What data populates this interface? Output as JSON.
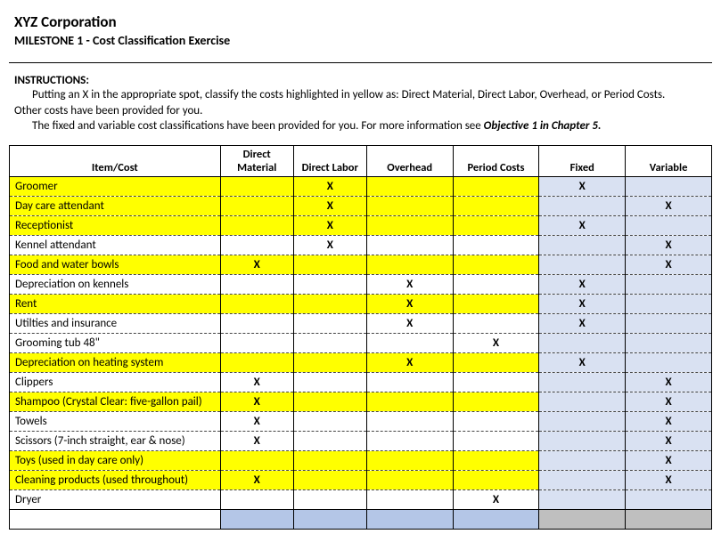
{
  "header": {
    "company": "XYZ Corporation",
    "milestone": "MILESTONE 1 - Cost Classification Exercise"
  },
  "instructions": {
    "label": "INSTRUCTIONS:",
    "line1": "Putting an X in the appropriate spot, classify the costs highlighted in yellow as:  Direct Material, Direct Labor, Overhead, or Period Costs.",
    "line2": "Other costs have been provided for you.",
    "line3a": "The fixed and variable cost classifications have been provided for you.  For more information see ",
    "line3b": "Objective 1 in Chapter 5."
  },
  "columns": {
    "item": "Item/Cost",
    "dm": "Direct Material",
    "dl": "Direct Labor",
    "oh": "Overhead",
    "pc": "Period Costs",
    "fixed": "Fixed",
    "variable": "Variable"
  },
  "mark": "X",
  "rows": [
    {
      "item": "Groomer",
      "hl": true,
      "dm": "",
      "dl": "X",
      "oh": "",
      "pc": "",
      "fixed": "X",
      "variable": ""
    },
    {
      "item": "Day care attendant",
      "hl": true,
      "dm": "",
      "dl": "X",
      "oh": "",
      "pc": "",
      "fixed": "",
      "variable": "X"
    },
    {
      "item": "Receptionist",
      "hl": true,
      "dm": "",
      "dl": "X",
      "oh": "",
      "pc": "",
      "fixed": "X",
      "variable": ""
    },
    {
      "item": "Kennel attendant",
      "hl": false,
      "dm": "",
      "dl": "X",
      "oh": "",
      "pc": "",
      "fixed": "",
      "variable": "X"
    },
    {
      "item": "Food and water bowls",
      "hl": true,
      "dm": "X",
      "dl": "",
      "oh": "",
      "pc": "",
      "fixed": "",
      "variable": "X"
    },
    {
      "item": "Depreciation on kennels",
      "hl": false,
      "dm": "",
      "dl": "",
      "oh": "X",
      "pc": "",
      "fixed": "X",
      "variable": ""
    },
    {
      "item": "Rent",
      "hl": true,
      "dm": "",
      "dl": "",
      "oh": "X",
      "pc": "",
      "fixed": "X",
      "variable": ""
    },
    {
      "item": "Utilties and insurance",
      "hl": false,
      "dm": "",
      "dl": "",
      "oh": "X",
      "pc": "",
      "fixed": "X",
      "variable": ""
    },
    {
      "item": "Grooming tub 48\"",
      "hl": false,
      "dm": "",
      "dl": "",
      "oh": "",
      "pc": "X",
      "fixed": "",
      "variable": ""
    },
    {
      "item": "Depreciation on heating system",
      "hl": true,
      "dm": "",
      "dl": "",
      "oh": "X",
      "pc": "",
      "fixed": "X",
      "variable": ""
    },
    {
      "item": "Clippers",
      "hl": false,
      "dm": "X",
      "dl": "",
      "oh": "",
      "pc": "",
      "fixed": "",
      "variable": "X"
    },
    {
      "item": "Shampoo (Crystal Clear: five-gallon pail)",
      "hl": true,
      "dm": "X",
      "dl": "",
      "oh": "",
      "pc": "",
      "fixed": "",
      "variable": "X"
    },
    {
      "item": "Towels",
      "hl": false,
      "dm": "X",
      "dl": "",
      "oh": "",
      "pc": "",
      "fixed": "",
      "variable": "X"
    },
    {
      "item": "Scissors (7-inch straight, ear & nose)",
      "hl": false,
      "dm": "X",
      "dl": "",
      "oh": "",
      "pc": "",
      "fixed": "",
      "variable": "X"
    },
    {
      "item": "Toys (used in day care only)",
      "hl": true,
      "dm": "",
      "dl": "",
      "oh": "",
      "pc": "",
      "fixed": "",
      "variable": "X"
    },
    {
      "item": "Cleaning products (used throughout)",
      "hl": true,
      "dm": "X",
      "dl": "",
      "oh": "",
      "pc": "",
      "fixed": "",
      "variable": "X"
    },
    {
      "item": "Dryer",
      "hl": false,
      "dm": "",
      "dl": "",
      "oh": "",
      "pc": "X",
      "fixed": "",
      "variable": ""
    }
  ]
}
